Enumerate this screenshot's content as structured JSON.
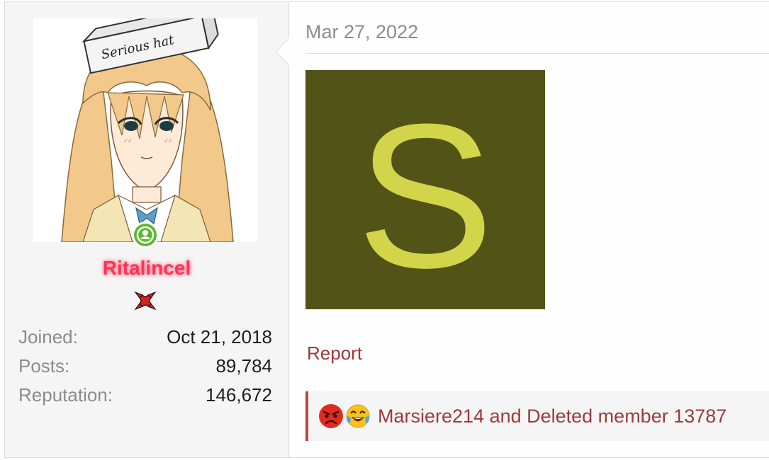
{
  "user": {
    "username": "Ritalincel",
    "avatar_caption": "Serious hat",
    "online_indicator_icon": "user-online-icon",
    "badge_icon": "anger-symbol-icon",
    "username_color": "#ff3355",
    "stats": [
      {
        "label": "Joined:",
        "value": "Oct 21, 2018"
      },
      {
        "label": "Posts:",
        "value": "89,784"
      },
      {
        "label": "Reputation:",
        "value": "146,672"
      }
    ]
  },
  "post": {
    "date": "Mar 27, 2022",
    "image_letter": "S",
    "image_bg_color": "#525317",
    "image_letter_color": "#d2d44a",
    "report_label": "Report",
    "reactions": {
      "icons": [
        "angry-face-icon",
        "laughing-crying-face-icon"
      ],
      "text": "Marsiere214 and Deleted member 13787"
    }
  }
}
